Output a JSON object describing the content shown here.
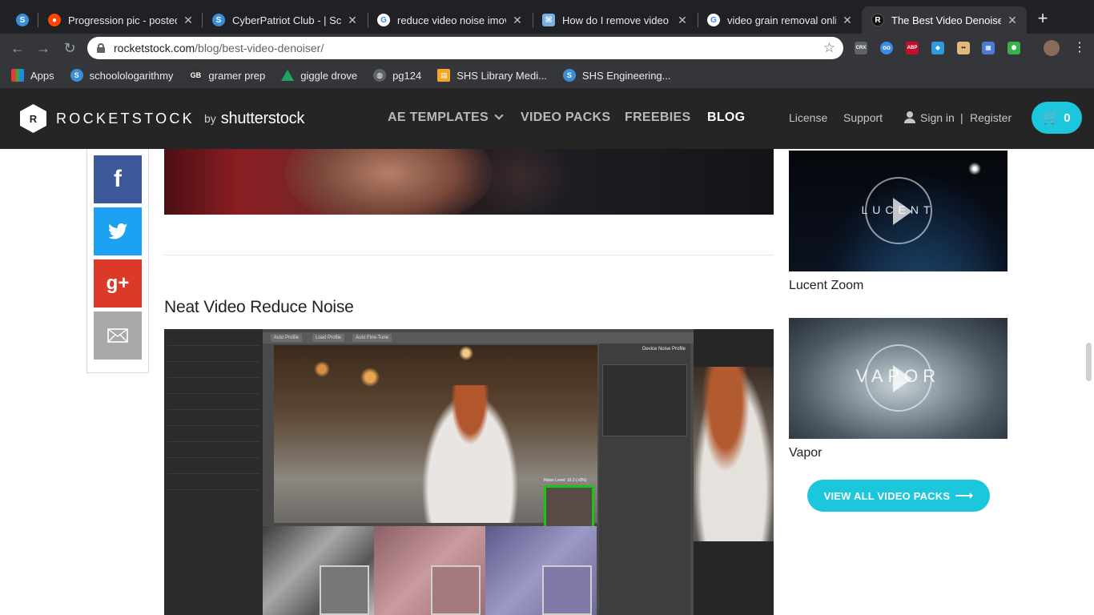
{
  "browser": {
    "tabs": [
      {
        "title": "Progression pic - posted",
        "favicon": "reddit-icon",
        "color": "#ff4500"
      },
      {
        "title": "CyberPatriot Club - | Sch",
        "favicon": "schoology-icon",
        "color": "#3a8fd8"
      },
      {
        "title": "reduce video noise imovi",
        "favicon": "google-icon",
        "color": "#4285f4"
      },
      {
        "title": "How do I remove video n",
        "favicon": "apple-support-icon",
        "color": "#7ab0e6"
      },
      {
        "title": "video grain removal onlin",
        "favicon": "google-icon",
        "color": "#4285f4"
      },
      {
        "title": "The Best Video Denoiser",
        "favicon": "rocketstock-icon",
        "color": "#111111",
        "active": true
      }
    ],
    "new_tab": "+",
    "url": {
      "host": "rocketstock.com",
      "path": "/blog/best-video-denoiser/"
    },
    "extensions": [
      {
        "name": "crx-icon",
        "label": "CRX",
        "color": "#5f6368"
      },
      {
        "name": "owl-icon",
        "label": "",
        "color": "#3c8ce7"
      },
      {
        "name": "adblock-icon",
        "label": "ABP",
        "color": "#c70d2c",
        "badge": "9"
      },
      {
        "name": "vscode-icon",
        "label": "",
        "color": "#2d9be0"
      },
      {
        "name": "face-icon",
        "label": "",
        "color": "#e4b87a"
      },
      {
        "name": "calendar-icon",
        "label": "",
        "color": "#4a7cd8"
      },
      {
        "name": "slash-icon",
        "label": "",
        "color": "#35363a"
      },
      {
        "name": "colorful-icon",
        "label": "",
        "color": "#36b24a"
      }
    ],
    "bookmarks": [
      {
        "label": "Apps",
        "icon": "apps-grid-icon",
        "color": "#e53935"
      },
      {
        "label": "schoolologarithmy",
        "icon": "schoology-icon",
        "color": "#3a8fd8"
      },
      {
        "label": "gramer prep",
        "icon": "gb-icon",
        "color": "#333333"
      },
      {
        "label": "giggle drove",
        "icon": "google-drive-icon",
        "color": "#1fa463"
      },
      {
        "label": "pg124",
        "icon": "globe-icon",
        "color": "#5f6368"
      },
      {
        "label": "SHS Library Medi...",
        "icon": "library-icon",
        "color": "#f5a623"
      },
      {
        "label": "SHS Engineering...",
        "icon": "schoology-icon",
        "color": "#3a8fd8"
      }
    ]
  },
  "site": {
    "logo_word": "ROCKETSTOCK",
    "logo_mark": "R",
    "logo_by": "by",
    "logo_brand": "shutterstock",
    "nav": {
      "ae_templates": "AE TEMPLATES",
      "video_packs": "VIDEO PACKS",
      "freebies": "FREEBIES",
      "blog": "BLOG"
    },
    "subnav": {
      "license": "License",
      "support": "Support",
      "sign_in": "Sign in",
      "divider": "|",
      "register": "Register"
    },
    "cart_count": "0",
    "accent_color": "#1cc6dc"
  },
  "share": {
    "facebook": "f",
    "google_plus": "g+"
  },
  "article": {
    "section_title": "Neat Video Reduce Noise",
    "screenshot": {
      "buttons": [
        "Auto Profile",
        "Load Profile",
        "Auto Fine-Tune"
      ],
      "panel_title": "Device Noise Profile",
      "noise_label": "Noise Level: 10.2 (+0%)"
    }
  },
  "sidebar": {
    "cards": [
      {
        "title": "Lucent Zoom",
        "overlay": "LUCENT"
      },
      {
        "title": "Vapor",
        "overlay": "VAPOR"
      }
    ],
    "view_all": "VIEW ALL VIDEO PACKS",
    "view_all_arrow": "⟶"
  }
}
